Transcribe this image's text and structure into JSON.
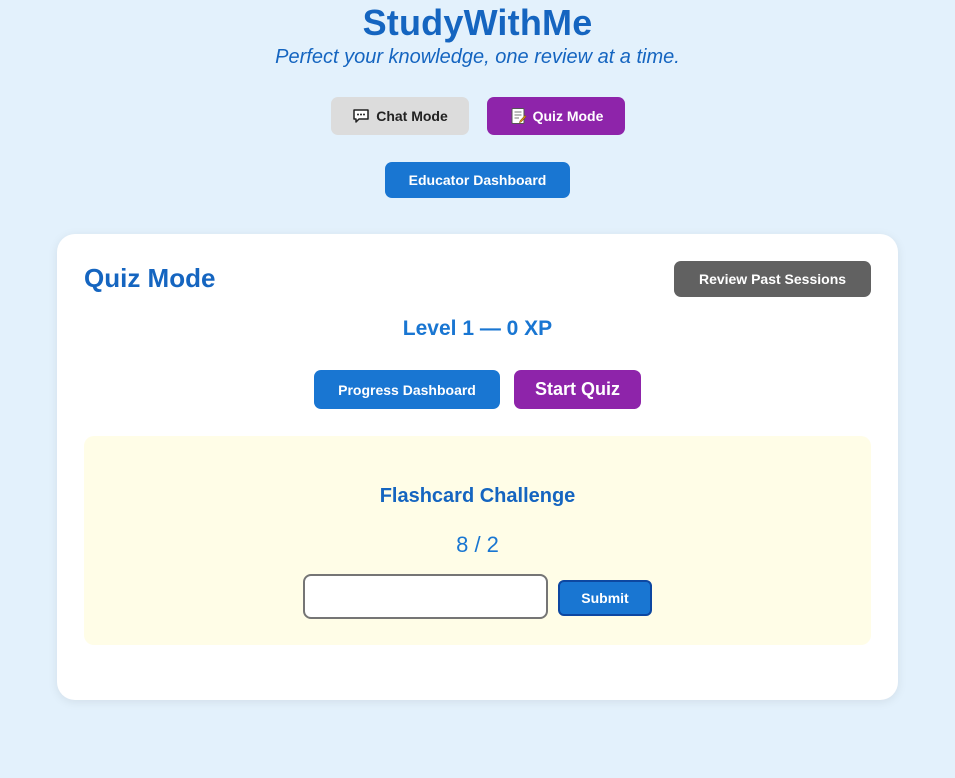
{
  "header": {
    "title": "StudyWithMe",
    "tagline": "Perfect your knowledge, one review at a time."
  },
  "modes": {
    "chat": {
      "label": "Chat Mode",
      "icon": "speech-bubble-icon"
    },
    "quiz": {
      "label": "Quiz Mode",
      "icon": "memo-icon",
      "active": true
    }
  },
  "educator_label": "Educator Dashboard",
  "quiz_card": {
    "title": "Quiz Mode",
    "review_label": "Review Past Sessions",
    "level_text": "Level 1 — 0 XP",
    "progress_label": "Progress Dashboard",
    "start_label": "Start Quiz",
    "flashcard": {
      "title": "Flashcard Challenge",
      "prompt": "8 / 2",
      "answer_value": "",
      "submit_label": "Submit"
    }
  },
  "colors": {
    "background": "#e3f1fc",
    "primary_blue": "#1976d2",
    "title_blue": "#1565c0",
    "purple": "#8e24aa",
    "grey_button": "#616161",
    "flashcard_panel": "#fffde7"
  }
}
